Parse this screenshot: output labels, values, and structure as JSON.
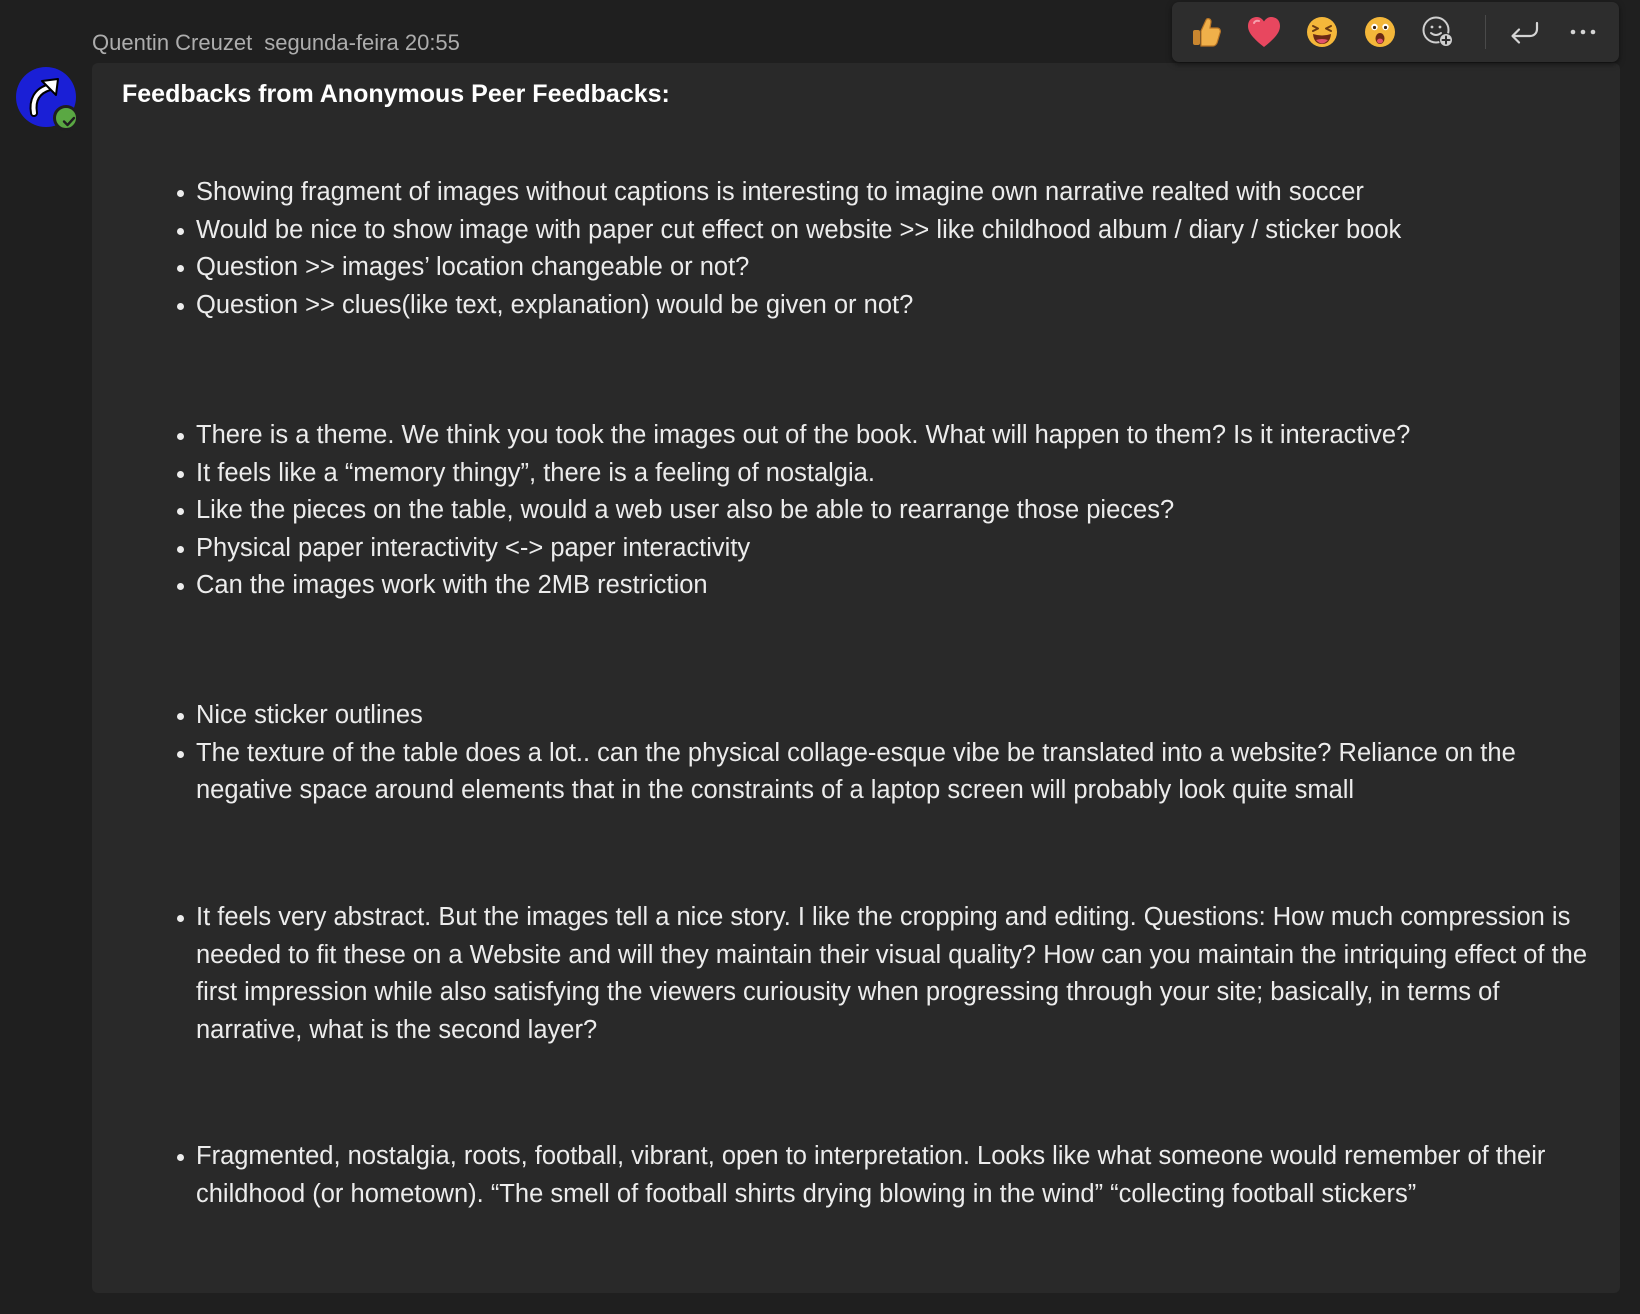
{
  "message": {
    "sender": "Quentin Creuzet",
    "timestamp": "segunda-feira 20:55",
    "heading": "Feedbacks from Anonymous Peer Feedbacks:",
    "feedback_groups": [
      {
        "items": [
          "Showing fragment of images without captions is interesting to imagine own narrative realted with soccer",
          "Would be nice to show image with paper cut effect on website >> like childhood album / diary / sticker book",
          "Question >> images’ location changeable or not?",
          "Question >> clues(like text, explanation) would be given or not?"
        ]
      },
      {
        "items": [
          "There is a theme. We think you took the images out of the book. What will happen to them? Is it interactive?",
          "It feels like a “memory thingy”, there is a feeling of nostalgia.",
          "Like the pieces on the table, would a web user also be able to rearrange those pieces?",
          "Physical paper interactivity <-> paper interactivity",
          "Can the images work with the 2MB restriction"
        ]
      },
      {
        "items": [
          "Nice sticker outlines",
          "The texture of the table does a lot.. can the physical collage-esque vibe be translated into a website? Reliance on the negative space around elements that in the constraints of a laptop screen will probably look quite small"
        ]
      },
      {
        "items": [
          "It feels very abstract. But the images tell a nice story. I like the cropping and editing. Questions: How much compression is needed to fit these on a Website and will they maintain their visual quality? How can you maintain the intriquing effect of the first impression while also satisfying the viewers curiousity when progressing through your site; basically, in terms of narrative, what is the second layer?"
        ]
      },
      {
        "items": [
          "Fragmented, nostalgia, roots, football, vibrant, open to interpretation. Looks like what someone would remember of their childhood (or hometown). “The smell of football shirts drying blowing in the wind” “collecting football stickers”"
        ]
      }
    ]
  },
  "reaction_toolbar": {
    "buttons": [
      {
        "name": "like-reaction-button",
        "icon": "thumbs-up-icon"
      },
      {
        "name": "heart-reaction-button",
        "icon": "heart-icon"
      },
      {
        "name": "laugh-reaction-button",
        "icon": "laughing-face-icon"
      },
      {
        "name": "surprised-reaction-button",
        "icon": "surprised-face-icon"
      },
      {
        "name": "add-reaction-button",
        "icon": "add-emoji-icon"
      },
      {
        "name": "reply-button",
        "icon": "reply-arrow-icon"
      },
      {
        "name": "more-options-button",
        "icon": "ellipsis-icon"
      }
    ]
  },
  "colors": {
    "background": "#1f1f1f",
    "bubble": "#292929",
    "avatar": "#1a1fd6",
    "presence_available": "#5aa843",
    "heart": "#e8475f",
    "emoji_yellow": "#f4b73a"
  }
}
